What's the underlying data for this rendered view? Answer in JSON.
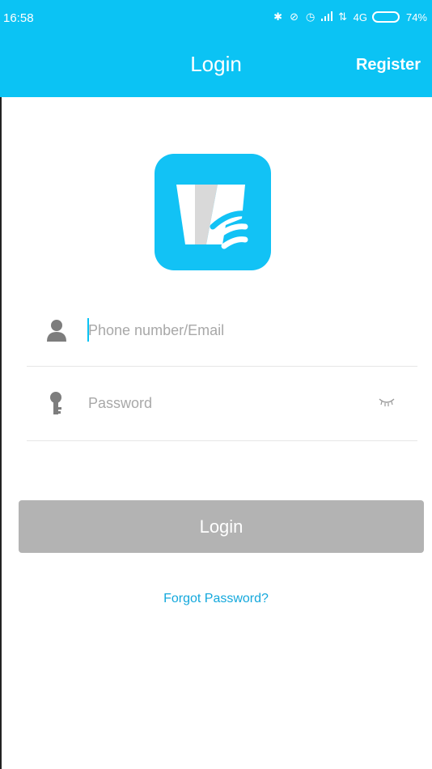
{
  "status_bar": {
    "time": "16:58",
    "icons": [
      "bluetooth-icon",
      "no-vibrate-icon",
      "alarm-icon",
      "signal-icon",
      "data-arrows-icon"
    ],
    "network": "4G",
    "battery_percent": "74%",
    "battery_level": 0.74
  },
  "app_bar": {
    "title": "Login",
    "register_label": "Register"
  },
  "logo": {
    "name": "app-logo-icon",
    "color": "#12c2f5"
  },
  "form": {
    "username_placeholder": "Phone number/Email",
    "username_value": "",
    "password_placeholder": "Password",
    "password_value": "",
    "user_icon": "person-icon",
    "password_icon": "key-icon",
    "toggle_icon": "eye-closed-icon"
  },
  "actions": {
    "login_label": "Login",
    "forgot_label": "Forgot Password?"
  },
  "colors": {
    "accent": "#0bc3f4",
    "button_disabled": "#b3b3b3",
    "link": "#14a8dc"
  }
}
